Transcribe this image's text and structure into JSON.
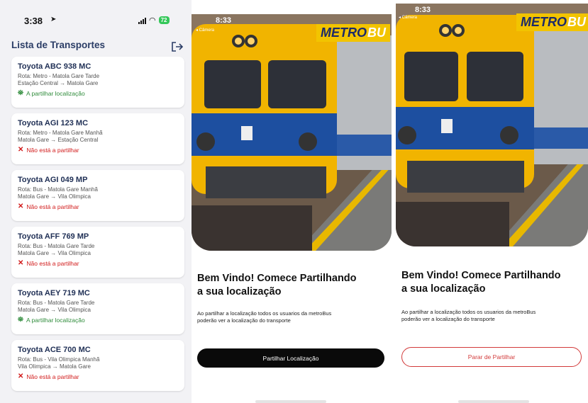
{
  "list_screen": {
    "status_time": "3:38",
    "battery": "72",
    "title": "Lista de Transportes",
    "transports": [
      {
        "name": "Toyota ABC 938 MC",
        "route": "Rota: Metro - Matola Gare Tarde",
        "stops": "Estação Central → Matola Gare",
        "status": "A partilhar localização",
        "sharing": true
      },
      {
        "name": "Toyota AGI 123 MC",
        "route": "Rota: Metro - Matola Gare Manhã",
        "stops": "Matola Gare → Estação Central",
        "status": "Não está a partilhar",
        "sharing": false
      },
      {
        "name": "Toyota AGI 049 MP",
        "route": "Rota: Bus - Matola Gare Manhã",
        "stops": "Matola Gare → Vila Olimpica",
        "status": "Não está a partilhar",
        "sharing": false
      },
      {
        "name": "Toyota AFF 769 MP",
        "route": "Rota: Bus - Matola Gare Tarde",
        "stops": "Matola Gare → Vila Olimpica",
        "status": "Não está a partilhar",
        "sharing": false
      },
      {
        "name": "Toyota AEY 719 MC",
        "route": "Rota: Bus - Matola Gare Tarde",
        "stops": "Matola Gare → Vila Olimpica",
        "status": "A partilhar localização",
        "sharing": true
      },
      {
        "name": "Toyota ACE 700 MC",
        "route": "Rota: Bus - Vila Olimpica Manhã",
        "stops": "Vila Olimpica → Matola Gare",
        "status": "Não está a partilhar",
        "sharing": false
      }
    ]
  },
  "welcome_screen": {
    "status_time": "8:33",
    "back_label": "◂ Câmera",
    "logo_left": "METRO",
    "logo_right": "BU",
    "heading_line1": "Bem Vindo! Comece Partilhando",
    "heading_line2": "a sua localização",
    "description_line1": "Ao partilhar a localização todos os usuarios da metroBus",
    "description_line2": "poderão ver a localização do transporte",
    "share_button": "Partilhar Localização"
  },
  "sharing_screen": {
    "status_time": "8:33",
    "back_label": "◂ Câmera",
    "logo_left": "METRO",
    "logo_right": "BU",
    "heading_line1": "Bem Vindo! Comece Partilhando",
    "heading_line2": "a sua localização",
    "description_line1": "Ao partilhar a localização todos os usuarios da metroBus",
    "description_line2": "poderão ver a localização do transporte",
    "stop_button": "Parar de Partilhar"
  },
  "colors": {
    "primary_text": "#1f2f55",
    "sharing_green": "#2e8b3a",
    "not_sharing_red": "#d11a1a",
    "logo_yellow": "#f2c400",
    "stop_red": "#d23a3a"
  }
}
